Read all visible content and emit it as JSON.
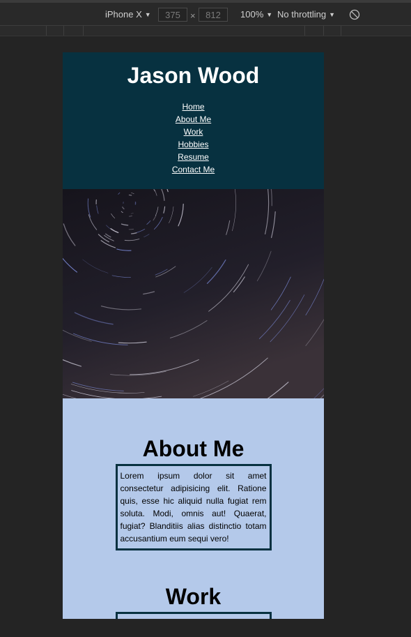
{
  "devtools": {
    "device": "iPhone X",
    "width": "375",
    "height": "812",
    "zoom": "100%",
    "throttling": "No throttling"
  },
  "site": {
    "title": "Jason Wood",
    "nav": [
      "Home",
      "About Me",
      "Work",
      "Hobbies",
      "Resume",
      "Contact Me"
    ],
    "about": {
      "heading": "About Me",
      "text": "Lorem ipsum dolor sit amet consectetur adipisicing elit. Ratione quis, esse hic aliquid nulla fugiat rem soluta. Modi, omnis aut! Quaerat, fugiat? Blanditiis alias distinctio totam accusantium eum sequi vero!"
    },
    "work": {
      "heading": "Work"
    }
  },
  "colors": {
    "header_bg": "#073140",
    "page_bg": "#b4c9ea"
  }
}
